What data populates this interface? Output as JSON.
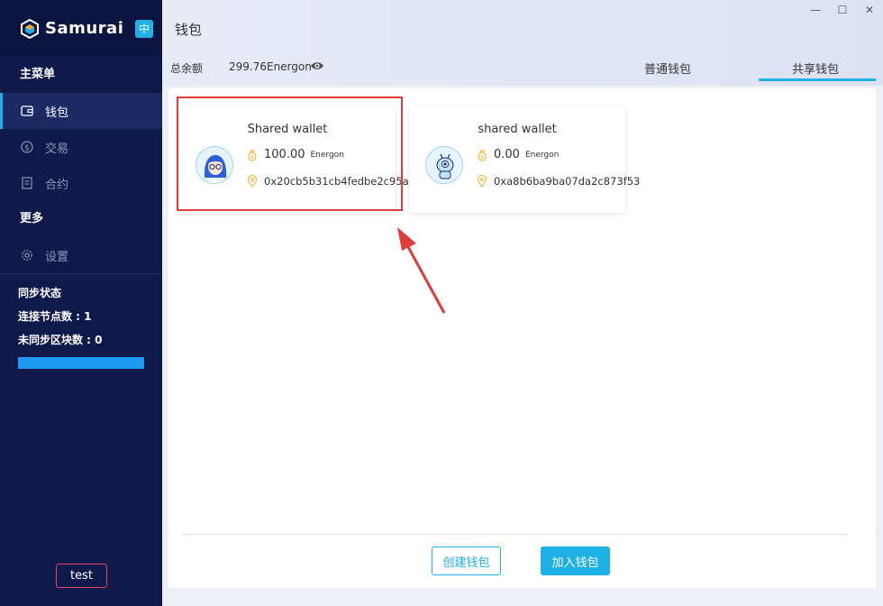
{
  "sidebar": {
    "brand": "Samurai",
    "lang": "中",
    "main_menu_title": "主菜单",
    "items": [
      {
        "label": "钱包",
        "icon": "wallet-icon",
        "active": true
      },
      {
        "label": "交易",
        "icon": "dollar-circle-icon",
        "active": false
      },
      {
        "label": "合约",
        "icon": "contract-icon",
        "active": false
      }
    ],
    "more_title": "更多",
    "settings_label": "设置",
    "sync": {
      "title": "同步状态",
      "nodes_label": "连接节点数 : ",
      "nodes_value": "1",
      "unsynced_label": "未同步区块数 : ",
      "unsynced_value": "0",
      "progress": 1.0
    },
    "user": "test"
  },
  "header": {
    "title": "钱包",
    "balance_label": "总余额",
    "balance_value": "299.76Energon",
    "tabs": [
      "普通钱包",
      "共享钱包"
    ],
    "active_tab": 1
  },
  "wallets": [
    {
      "name": "Shared wallet",
      "amount": "100.00",
      "unit": "Energon",
      "address": "0x20cb5b31cb4fedbe2c95a"
    },
    {
      "name": "shared wallet",
      "amount": "0.00",
      "unit": "Energon",
      "address": "0xa8b6ba9ba07da2c873f53"
    }
  ],
  "actions": {
    "create": "创建钱包",
    "join": "加入钱包"
  },
  "colors": {
    "accent": "#1fb1e6",
    "sidebar_bg": "#0f1a4a",
    "highlight": "#e23b3b"
  }
}
